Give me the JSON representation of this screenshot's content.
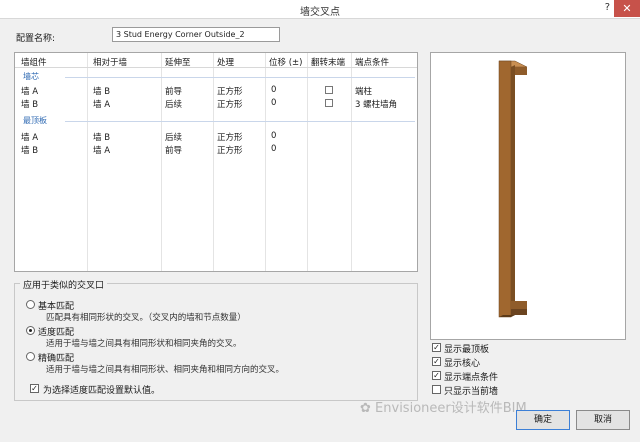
{
  "window": {
    "title": "墙交叉点",
    "help": "?",
    "close": "✕"
  },
  "config": {
    "label": "配置名称:",
    "value": "3 Stud Energy Corner Outside_2"
  },
  "table": {
    "headers": [
      "墙组件",
      "相对于墙",
      "延伸至",
      "处理",
      "位移 (±)",
      "翻转末端",
      "端点条件"
    ],
    "groups": [
      {
        "name": "墙芯",
        "rows": [
          {
            "c1": "墙 A",
            "c2": "墙 B",
            "c3": "前导",
            "c4": "正方形",
            "c5": "0",
            "c7": "端柱"
          },
          {
            "c1": "墙 B",
            "c2": "墙 A",
            "c3": "后续",
            "c4": "正方形",
            "c5": "0",
            "c7": "3 螺柱墙角"
          }
        ]
      },
      {
        "name": "最顶板",
        "rows": [
          {
            "c1": "墙 A",
            "c2": "墙 B",
            "c3": "后续",
            "c4": "正方形",
            "c5": "0"
          },
          {
            "c1": "墙 B",
            "c2": "墙 A",
            "c3": "前导",
            "c4": "正方形",
            "c5": "0"
          }
        ]
      }
    ]
  },
  "apply": {
    "legend": "应用于类似的交叉口",
    "options": [
      {
        "label": "基本匹配",
        "desc": "匹配具有相同形状的交叉。（交叉内的墙和节点数量）",
        "selected": false
      },
      {
        "label": "适度匹配",
        "desc": "适用于墙与墙之间具有相同形状和相同夹角的交叉。",
        "selected": true
      },
      {
        "label": "精确匹配",
        "desc": "适用于墙与墙之间具有相同形状、相同夹角和相同方向的交叉。",
        "selected": false
      }
    ],
    "default_label": "为选择适度匹配设置默认值。"
  },
  "view_options": [
    {
      "label": "显示最顶板",
      "checked": true
    },
    {
      "label": "显示核心",
      "checked": true
    },
    {
      "label": "显示端点条件",
      "checked": true
    },
    {
      "label": "只显示当前墙",
      "checked": false
    }
  ],
  "buttons": {
    "ok": "确定",
    "cancel": "取消"
  },
  "watermark": "Envisioneer设计软件BIM",
  "colors": {
    "accent": "#2f6ab3",
    "wood": "#a0672f",
    "close": "#c7524a"
  }
}
